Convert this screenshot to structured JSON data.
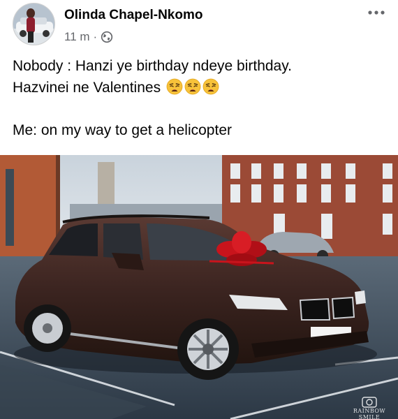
{
  "post": {
    "author_name": "Olinda Chapel-Nkomo",
    "timestamp": "11 m",
    "separator": "·",
    "privacy_icon": "globe-icon",
    "more_icon": "more-options-icon",
    "text": {
      "line1": "Nobody : Hanzi ye birthday ndeye birthday.",
      "line2": "Hazvinei ne Valentines",
      "line2_emoji": [
        "weary-face-icon",
        "weary-face-icon",
        "weary-face-icon"
      ],
      "line3": "Me: on my way to get a helicopter"
    },
    "photo": {
      "description_icon": "photo-car-with-bow",
      "watermark": "RAINBOW SMILE"
    }
  },
  "colors": {
    "text_primary": "#050505",
    "text_secondary": "#65676b",
    "emoji_yellow": "#f7c23a",
    "car_brown": "#3b2420",
    "bow_red": "#c8141c"
  }
}
